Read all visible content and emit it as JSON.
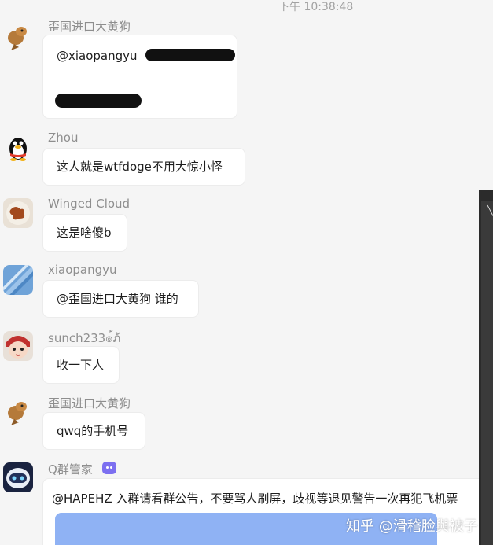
{
  "timestamp": "下午 10:38:48",
  "messages": [
    {
      "sender": "歪国进口大黄狗",
      "text": "@xiaopangyu",
      "avatar_icon": "doge-avatar-icon"
    },
    {
      "sender": "Zhou",
      "text": "这人就是wtfdoge不用大惊小怪",
      "avatar_icon": "penguin-avatar-icon"
    },
    {
      "sender": "Winged Cloud",
      "text": "这是啥傻b",
      "avatar_icon": "food-plate-avatar-icon"
    },
    {
      "sender": "xiaopangyu",
      "text": "@歪国进口大黄狗 谁的",
      "avatar_icon": "feather-avatar-icon"
    },
    {
      "sender": "sunch233๏้ภ้",
      "text": "收一下人",
      "avatar_icon": "cartoon-girl-avatar-icon"
    },
    {
      "sender": "歪国进口大黄狗",
      "text": "qwq的手机号",
      "avatar_icon": "doge-avatar-icon"
    },
    {
      "sender": "Q群管家",
      "text": "@HAPEHZ 入群请看群公告，不要骂人刷屏，歧视等退见警告一次再犯飞机票",
      "avatar_icon": "robot-avatar-icon"
    }
  ],
  "watermark": "知乎 @滑稽脸與被子",
  "colors": {
    "background": "#f5f5f5",
    "bubble": "#ffffff",
    "sender_text": "#8e8e8e",
    "bot_badge": "#7c6ff0",
    "image_preview": "#8fb2f4"
  }
}
